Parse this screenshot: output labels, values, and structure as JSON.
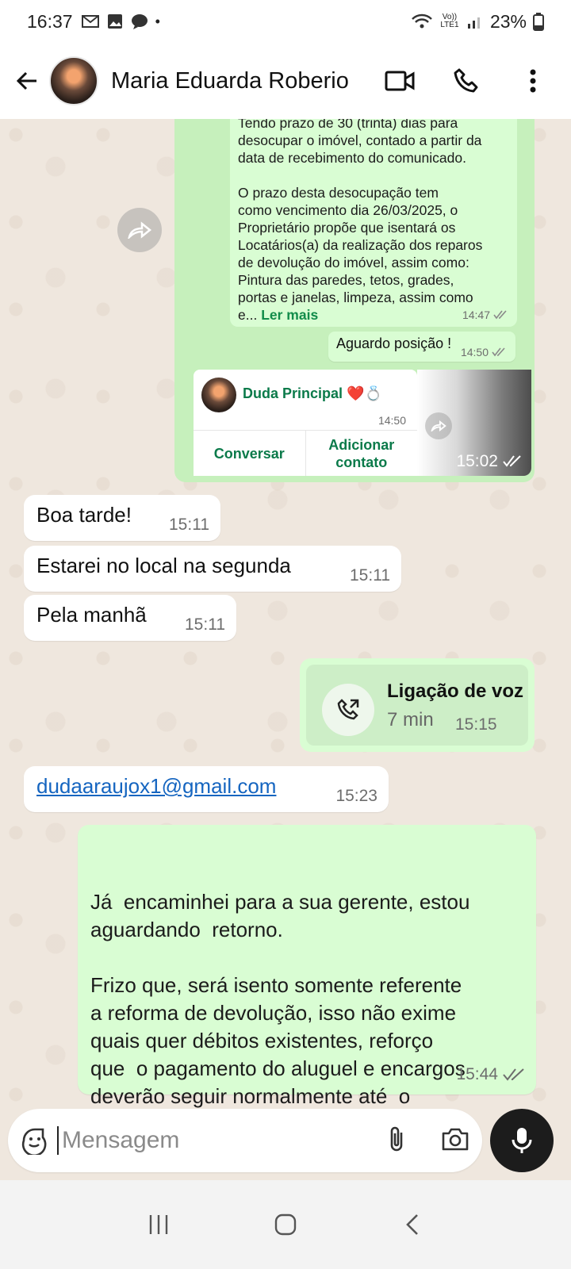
{
  "status_bar": {
    "time": "16:37",
    "network": "Vo)) LTE1",
    "battery": "23%"
  },
  "header": {
    "contact_name": "Maria Eduarda Roberio"
  },
  "messages": {
    "forwarded_text": {
      "line0": "Tendo  prazo de 30 (trinta) dias para",
      "line1": "desocupar o imóvel, contado a partir da",
      "line2": "data de recebimento do comunicado.",
      "line3": "O prazo desta desocupação tem",
      "line4": "como vencimento dia 26/03/2025, o",
      "line5": "Proprietário propõe que isentará os",
      "line6": "Locatários(a) da realização dos reparos",
      "line7": "de devolução do imóvel, assim como:",
      "line8": "Pintura das paredes, tetos, grades,",
      "line9": "portas e janelas, limpeza, assim como",
      "line10": "e...",
      "read_more": "Ler mais",
      "time": "14:47"
    },
    "aguardo": {
      "text": "Aguardo posição !",
      "time": "14:50"
    },
    "contact_card": {
      "name": "Duda Principal ❤️💍",
      "time": "14:50",
      "action_chat": "Conversar",
      "action_add": "Adicionar contato",
      "outer_time": "15:02"
    },
    "in1": {
      "text": "Boa tarde!",
      "time": "15:11"
    },
    "in2": {
      "text": "Estarei no local na segunda",
      "time": "15:11"
    },
    "in3": {
      "text": "Pela manhã",
      "time": "15:11"
    },
    "call": {
      "title": "Ligação de voz",
      "duration": "7 min",
      "time": "15:15"
    },
    "email": {
      "text": "dudaaraujox1@gmail.com",
      "time": "15:23"
    },
    "long_reply": {
      "text": "Já  encaminhei para a sua gerente, estou\naguardando  retorno.\n\nFrizo que, será isento somente referente\na reforma de devolução, isso não exime\nquais quer débitos existentes, reforço\nque  o pagamento do aluguel e encargos\ndeverão seguir normalmente até  o\nencerramento contratual.",
      "time": "15:44"
    }
  },
  "composer": {
    "placeholder": "Mensagem"
  }
}
